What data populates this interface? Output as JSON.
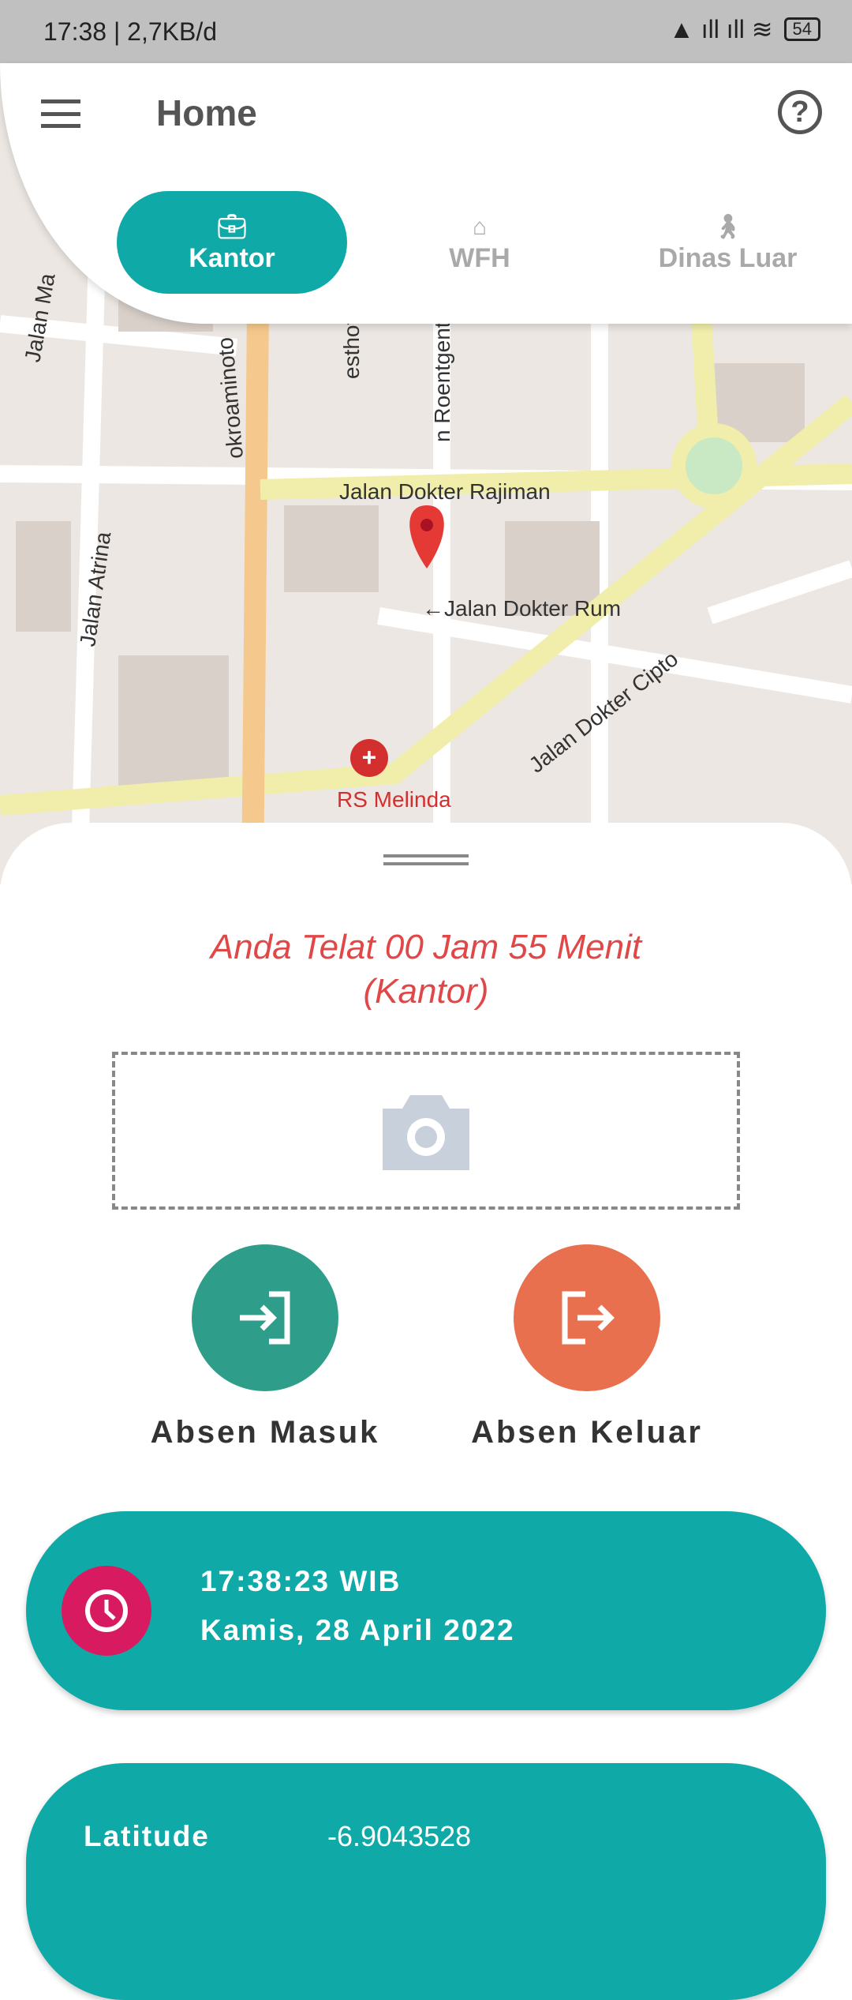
{
  "status_bar": {
    "text": "17:38 | 2,7KB/d",
    "battery": "54"
  },
  "header": {
    "title": "Home",
    "menu_icon": "hamburger-icon",
    "help_icon": "help-circle-icon"
  },
  "tabs": [
    {
      "label": "Kantor",
      "icon": "briefcase-icon",
      "active": true
    },
    {
      "label": "WFH",
      "icon": "home-icon",
      "active": false
    },
    {
      "label": "Dinas Luar",
      "icon": "person-waving-icon",
      "active": false
    }
  ],
  "map": {
    "labels": {
      "rajiman": "Jalan Dokter Rajiman",
      "rum": "←Jalan Dokter Rum",
      "cipto": "Jalan Dokter Cipto",
      "atrina": "Jalan Atrina",
      "roentgen": "n Roentgent",
      "tjokro": "okroaminoto",
      "esthoff": "esthoff",
      "jalanma": "Jalan Ma",
      "hospital": "RS Melinda"
    }
  },
  "sheet": {
    "late_line1": "Anda Telat 00 Jam 55 Menit",
    "late_line2": "(Kantor)",
    "check_in": "Absen Masuk",
    "check_out": "Absen Keluar"
  },
  "time_card": {
    "time": "17:38:23 WIB",
    "date": "Kamis, 28 April 2022"
  },
  "location": {
    "lat_label": "Latitude",
    "lat_value": "-6.9043528"
  },
  "colors": {
    "primary": "#0fa9a8",
    "check_in": "#2e9e8a",
    "check_out": "#e8704f",
    "late": "#e04848",
    "clock": "#d81b60"
  }
}
